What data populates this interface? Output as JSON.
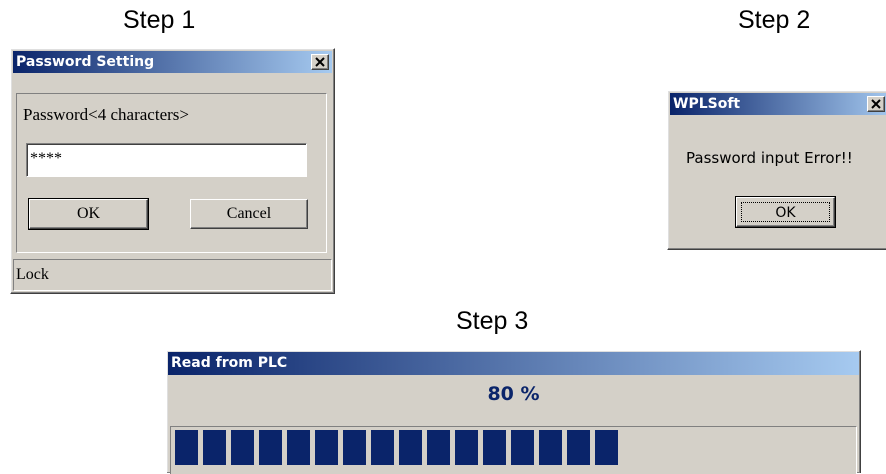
{
  "steps": {
    "step1": "Step 1",
    "step2": "Step 2",
    "step3": "Step 3"
  },
  "password_dialog": {
    "title": "Password Setting",
    "prompt": "Password<4 characters>",
    "password_value": "****",
    "ok_label": "OK",
    "cancel_label": "Cancel",
    "status": "Lock"
  },
  "error_dialog": {
    "title": "WPLSoft",
    "message": "Password input Error!!",
    "ok_label": "OK"
  },
  "progress_dialog": {
    "title": "Read from PLC",
    "percent_text": "80 %",
    "progress": 0.8
  },
  "colors": {
    "title_gradient_start": "#0a246a",
    "title_gradient_end": "#a6caf0",
    "dialog_face": "#d4d0c8",
    "progress_fill": "#0a246a"
  },
  "icons": {
    "close": "close-icon"
  }
}
